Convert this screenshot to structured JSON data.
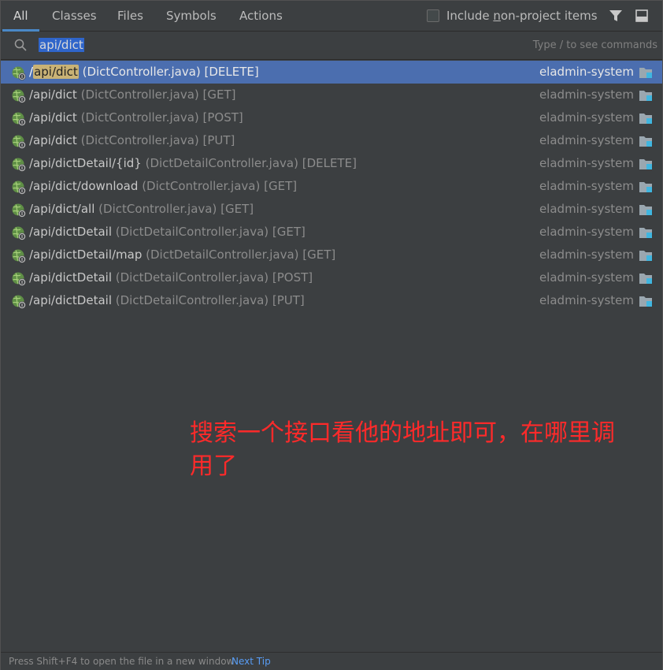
{
  "tabs": [
    {
      "label": "All",
      "active": true
    },
    {
      "label": "Classes"
    },
    {
      "label": "Files"
    },
    {
      "label": "Symbols"
    },
    {
      "label": "Actions"
    }
  ],
  "options": {
    "include_prefix": "Include ",
    "include_underlined": "n",
    "include_suffix": "on-project items",
    "include_checked": false
  },
  "search": {
    "value": "api/dict",
    "hint": "Type / to see commands"
  },
  "results": [
    {
      "pre": "/",
      "match": "api/dict",
      "rest": "",
      "meta": "(DictController.java) [DELETE]",
      "module": "eladmin-system",
      "selected": true
    },
    {
      "pre": "",
      "match": "/api/dict",
      "rest": "",
      "meta": "(DictController.java) [GET]",
      "module": "eladmin-system"
    },
    {
      "pre": "",
      "match": "/api/dict",
      "rest": "",
      "meta": "(DictController.java) [POST]",
      "module": "eladmin-system"
    },
    {
      "pre": "",
      "match": "/api/dict",
      "rest": "",
      "meta": "(DictController.java) [PUT]",
      "module": "eladmin-system"
    },
    {
      "pre": "",
      "match": "/api/dictDetail/{id}",
      "rest": "",
      "meta": "(DictDetailController.java) [DELETE]",
      "module": "eladmin-system"
    },
    {
      "pre": "",
      "match": "/api/dict/download",
      "rest": "",
      "meta": "(DictController.java) [GET]",
      "module": "eladmin-system"
    },
    {
      "pre": "",
      "match": "/api/dict/all",
      "rest": "",
      "meta": "(DictController.java) [GET]",
      "module": "eladmin-system"
    },
    {
      "pre": "",
      "match": "/api/dictDetail",
      "rest": "",
      "meta": "(DictDetailController.java) [GET]",
      "module": "eladmin-system"
    },
    {
      "pre": "",
      "match": "/api/dictDetail/map",
      "rest": "",
      "meta": "(DictDetailController.java) [GET]",
      "module": "eladmin-system"
    },
    {
      "pre": "",
      "match": "/api/dictDetail",
      "rest": "",
      "meta": "(DictDetailController.java) [POST]",
      "module": "eladmin-system"
    },
    {
      "pre": "",
      "match": "/api/dictDetail",
      "rest": "",
      "meta": "(DictDetailController.java) [PUT]",
      "module": "eladmin-system"
    }
  ],
  "annotation": {
    "line1": "搜索一个接口看他的地址即可，在哪里调",
    "line2": "用了"
  },
  "footer": {
    "tip": "Press Shift+F4 to open the file in a new window",
    "next_tip": "Next Tip"
  },
  "colors": {
    "background": "#3c3f41",
    "selection": "#4b6eaf",
    "highlight": "#c9b275",
    "annotation": "#ff2a2a",
    "link": "#589df6"
  },
  "icons": {
    "endpoint": "endpoint-globe-icon",
    "module": "module-folder-icon",
    "filter": "filter-funnel-icon",
    "preview": "preview-pane-icon",
    "search": "search-icon"
  }
}
